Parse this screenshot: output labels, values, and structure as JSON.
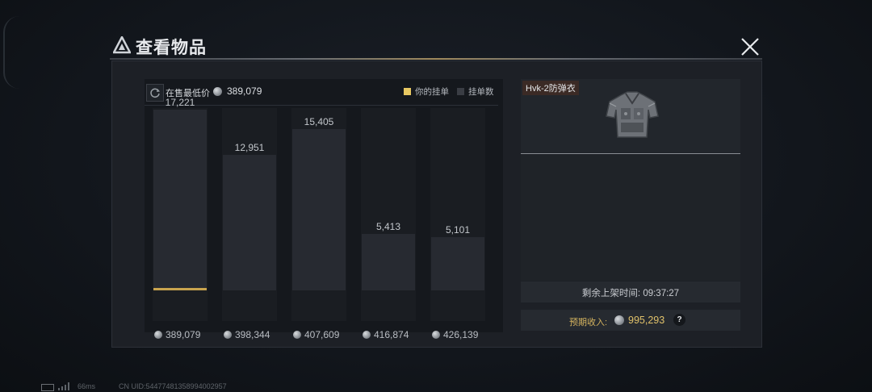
{
  "dialog": {
    "title": "查看物品"
  },
  "chart": {
    "lowest_label": "在售最低价",
    "lowest_value": "389,079",
    "legend_mine": "你的挂单",
    "legend_count": "挂单数",
    "colors": {
      "mine": "#e8c862",
      "count": "#3a3d44"
    }
  },
  "chart_data": {
    "type": "bar",
    "categories": [
      "389,079",
      "398,344",
      "407,609",
      "416,874",
      "426,139"
    ],
    "values": [
      17221,
      12951,
      15405,
      5413,
      5101
    ],
    "value_labels": [
      "17,221",
      "12,951",
      "15,405",
      "5,413",
      "5,101"
    ],
    "ylim": [
      0,
      17221
    ],
    "my_listing_category": "389,079",
    "legend": [
      "你的挂单",
      "挂单数"
    ]
  },
  "item": {
    "name": "Hvk-2防弹衣",
    "image_icon": "body-armor-vest"
  },
  "listing": {
    "remaining_label": "剩余上架时间:",
    "remaining_time": "09:37:27",
    "income_label": "预期收入:",
    "income_value": "995,293",
    "help_label": "?"
  },
  "footer": {
    "ping": "66ms",
    "uid": "CN UID:544774813589940​02957"
  }
}
